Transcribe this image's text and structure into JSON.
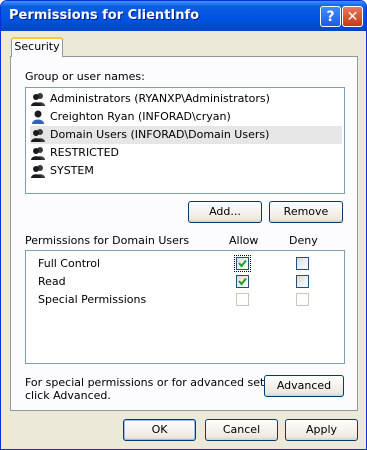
{
  "window": {
    "title": "Permissions for ClientInfo"
  },
  "titlebar": {
    "help_glyph": "?",
    "close_glyph": "✕"
  },
  "tab": {
    "label": "Security"
  },
  "groups": {
    "label": "Group or user names:",
    "items": [
      {
        "name": "Administrators (RYANXP\\Administrators)",
        "icon": "group-icon"
      },
      {
        "name": "Creighton Ryan (INFORAD\\cryan)",
        "icon": "user-icon"
      },
      {
        "name": "Domain Users (INFORAD\\Domain Users)",
        "icon": "group-icon",
        "selected": true
      },
      {
        "name": "RESTRICTED",
        "icon": "group-icon"
      },
      {
        "name": "SYSTEM",
        "icon": "group-icon"
      }
    ]
  },
  "buttons": {
    "add": "Add...",
    "remove": "Remove",
    "advanced": "Advanced",
    "ok": "OK",
    "cancel": "Cancel",
    "apply": "Apply"
  },
  "permissions": {
    "label": "Permissions for Domain Users",
    "allow_header": "Allow",
    "deny_header": "Deny",
    "rows": [
      {
        "name": "Full Control",
        "allow": true,
        "deny": false,
        "disabled": false
      },
      {
        "name": "Read",
        "allow": true,
        "deny": false,
        "disabled": false
      },
      {
        "name": "Special Permissions",
        "allow": false,
        "deny": false,
        "disabled": true
      }
    ]
  },
  "advanced_note": {
    "line1": "For special permissions or for advanced settings,",
    "line2": "click Advanced."
  },
  "colors": {
    "titlebar": "#0054e3",
    "dialog": "#ece9d8",
    "check": "#21a121"
  }
}
